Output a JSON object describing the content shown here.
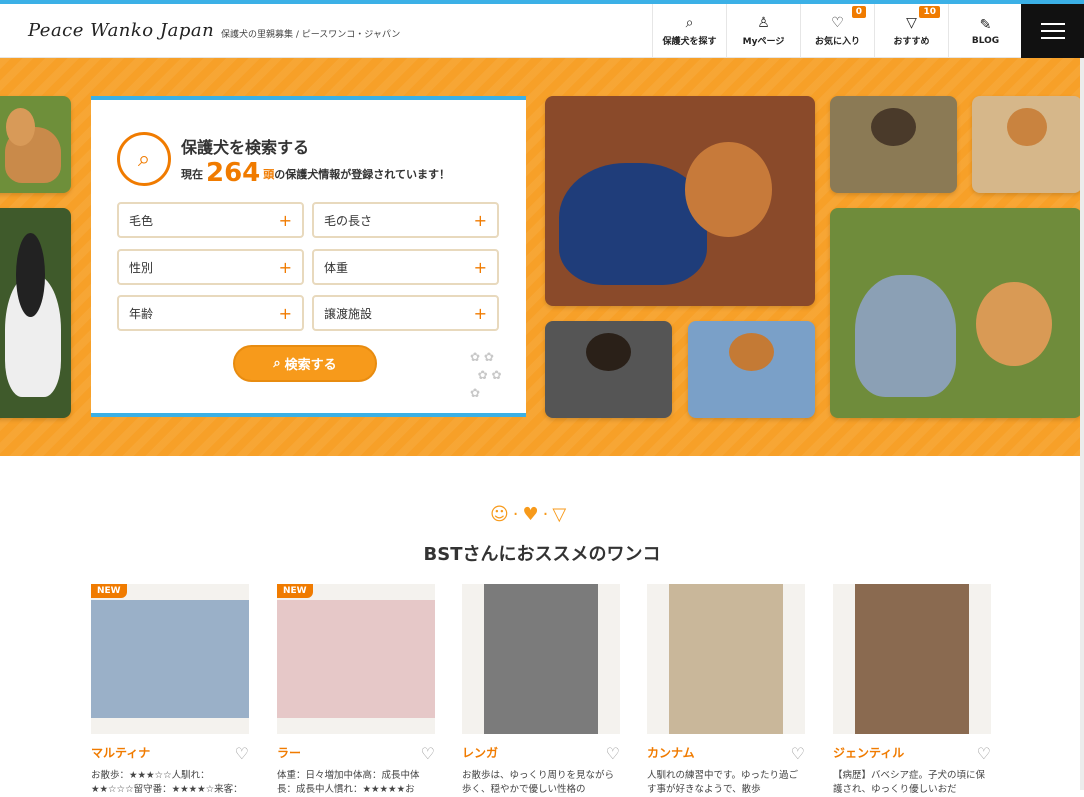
{
  "header": {
    "logo": "Peace Wanko Japan",
    "tagline": "保護犬の里親募集 / ピースワンコ・ジャパン",
    "nav": [
      {
        "label": "保護犬を探す",
        "icon": "search-icon",
        "glyph": "⌕",
        "badge": ""
      },
      {
        "label": "Myページ",
        "icon": "user-icon",
        "glyph": "♙",
        "badge": ""
      },
      {
        "label": "お気に入り",
        "icon": "heart-icon",
        "glyph": "♡",
        "badge": "0"
      },
      {
        "label": "おすすめ",
        "icon": "dog-face-icon",
        "glyph": "▽",
        "badge": "10"
      },
      {
        "label": "BLOG",
        "icon": "pencil-icon",
        "glyph": "✎",
        "badge": ""
      }
    ]
  },
  "search": {
    "title": "保護犬を検索する",
    "count_prefix": "現在",
    "count": "264",
    "count_unit": "頭",
    "count_suffix": "の保護犬情報が登録されています！",
    "filters": [
      "毛色",
      "毛の長さ",
      "性別",
      "体重",
      "年齢",
      "譲渡施設"
    ],
    "plus": "+",
    "button": "検索する"
  },
  "recommend": {
    "title": "BSTさんにおススメのワンコ",
    "new_label": "NEW",
    "dogs": [
      {
        "name": "マルティナ",
        "new": true,
        "desc": "お散歩：★★★☆☆人馴れ：★★☆☆☆留守番：★★★★☆来客：★"
      },
      {
        "name": "ラー",
        "new": true,
        "desc": "体重：日々増加中体高：成長中体長：成長中人慣れ：★★★★★お"
      },
      {
        "name": "レンガ",
        "new": false,
        "desc": "お散歩は、ゆっくり周りを見ながら歩く、穏やかで優しい性格の"
      },
      {
        "name": "カンナム",
        "new": false,
        "desc": "人馴れの練習中です。ゆったり過ごす事が好きなようで、散歩"
      },
      {
        "name": "ジェンティル",
        "new": false,
        "desc": "【病歴】バベシア症。子犬の頃に保護され、ゆっくり優しいおだ"
      }
    ]
  },
  "colors": {
    "accent": "#f07b00",
    "hero_bg": "#f7a028",
    "topline": "#3bb0e6"
  }
}
